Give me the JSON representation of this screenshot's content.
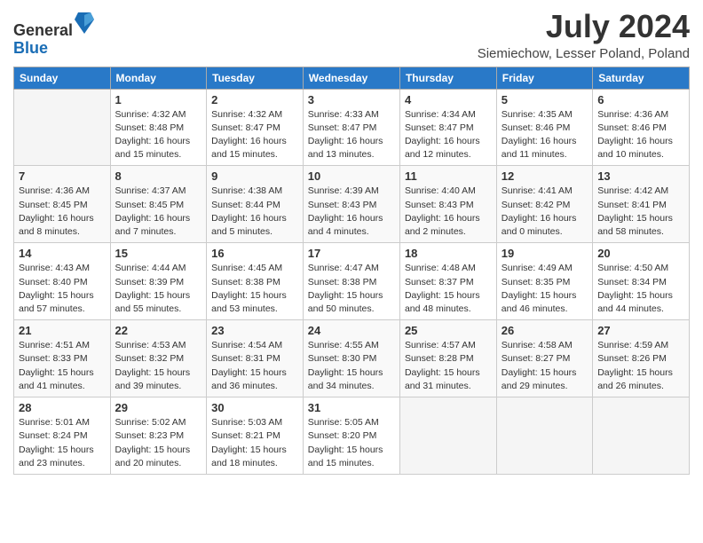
{
  "logo": {
    "text_general": "General",
    "text_blue": "Blue"
  },
  "title": {
    "month_year": "July 2024",
    "location": "Siemiechow, Lesser Poland, Poland"
  },
  "calendar": {
    "headers": [
      "Sunday",
      "Monday",
      "Tuesday",
      "Wednesday",
      "Thursday",
      "Friday",
      "Saturday"
    ],
    "weeks": [
      [
        {
          "day": "",
          "content": ""
        },
        {
          "day": "1",
          "content": "Sunrise: 4:32 AM\nSunset: 8:48 PM\nDaylight: 16 hours\nand 15 minutes."
        },
        {
          "day": "2",
          "content": "Sunrise: 4:32 AM\nSunset: 8:47 PM\nDaylight: 16 hours\nand 15 minutes."
        },
        {
          "day": "3",
          "content": "Sunrise: 4:33 AM\nSunset: 8:47 PM\nDaylight: 16 hours\nand 13 minutes."
        },
        {
          "day": "4",
          "content": "Sunrise: 4:34 AM\nSunset: 8:47 PM\nDaylight: 16 hours\nand 12 minutes."
        },
        {
          "day": "5",
          "content": "Sunrise: 4:35 AM\nSunset: 8:46 PM\nDaylight: 16 hours\nand 11 minutes."
        },
        {
          "day": "6",
          "content": "Sunrise: 4:36 AM\nSunset: 8:46 PM\nDaylight: 16 hours\nand 10 minutes."
        }
      ],
      [
        {
          "day": "7",
          "content": "Sunrise: 4:36 AM\nSunset: 8:45 PM\nDaylight: 16 hours\nand 8 minutes."
        },
        {
          "day": "8",
          "content": "Sunrise: 4:37 AM\nSunset: 8:45 PM\nDaylight: 16 hours\nand 7 minutes."
        },
        {
          "day": "9",
          "content": "Sunrise: 4:38 AM\nSunset: 8:44 PM\nDaylight: 16 hours\nand 5 minutes."
        },
        {
          "day": "10",
          "content": "Sunrise: 4:39 AM\nSunset: 8:43 PM\nDaylight: 16 hours\nand 4 minutes."
        },
        {
          "day": "11",
          "content": "Sunrise: 4:40 AM\nSunset: 8:43 PM\nDaylight: 16 hours\nand 2 minutes."
        },
        {
          "day": "12",
          "content": "Sunrise: 4:41 AM\nSunset: 8:42 PM\nDaylight: 16 hours\nand 0 minutes."
        },
        {
          "day": "13",
          "content": "Sunrise: 4:42 AM\nSunset: 8:41 PM\nDaylight: 15 hours\nand 58 minutes."
        }
      ],
      [
        {
          "day": "14",
          "content": "Sunrise: 4:43 AM\nSunset: 8:40 PM\nDaylight: 15 hours\nand 57 minutes."
        },
        {
          "day": "15",
          "content": "Sunrise: 4:44 AM\nSunset: 8:39 PM\nDaylight: 15 hours\nand 55 minutes."
        },
        {
          "day": "16",
          "content": "Sunrise: 4:45 AM\nSunset: 8:38 PM\nDaylight: 15 hours\nand 53 minutes."
        },
        {
          "day": "17",
          "content": "Sunrise: 4:47 AM\nSunset: 8:38 PM\nDaylight: 15 hours\nand 50 minutes."
        },
        {
          "day": "18",
          "content": "Sunrise: 4:48 AM\nSunset: 8:37 PM\nDaylight: 15 hours\nand 48 minutes."
        },
        {
          "day": "19",
          "content": "Sunrise: 4:49 AM\nSunset: 8:35 PM\nDaylight: 15 hours\nand 46 minutes."
        },
        {
          "day": "20",
          "content": "Sunrise: 4:50 AM\nSunset: 8:34 PM\nDaylight: 15 hours\nand 44 minutes."
        }
      ],
      [
        {
          "day": "21",
          "content": "Sunrise: 4:51 AM\nSunset: 8:33 PM\nDaylight: 15 hours\nand 41 minutes."
        },
        {
          "day": "22",
          "content": "Sunrise: 4:53 AM\nSunset: 8:32 PM\nDaylight: 15 hours\nand 39 minutes."
        },
        {
          "day": "23",
          "content": "Sunrise: 4:54 AM\nSunset: 8:31 PM\nDaylight: 15 hours\nand 36 minutes."
        },
        {
          "day": "24",
          "content": "Sunrise: 4:55 AM\nSunset: 8:30 PM\nDaylight: 15 hours\nand 34 minutes."
        },
        {
          "day": "25",
          "content": "Sunrise: 4:57 AM\nSunset: 8:28 PM\nDaylight: 15 hours\nand 31 minutes."
        },
        {
          "day": "26",
          "content": "Sunrise: 4:58 AM\nSunset: 8:27 PM\nDaylight: 15 hours\nand 29 minutes."
        },
        {
          "day": "27",
          "content": "Sunrise: 4:59 AM\nSunset: 8:26 PM\nDaylight: 15 hours\nand 26 minutes."
        }
      ],
      [
        {
          "day": "28",
          "content": "Sunrise: 5:01 AM\nSunset: 8:24 PM\nDaylight: 15 hours\nand 23 minutes."
        },
        {
          "day": "29",
          "content": "Sunrise: 5:02 AM\nSunset: 8:23 PM\nDaylight: 15 hours\nand 20 minutes."
        },
        {
          "day": "30",
          "content": "Sunrise: 5:03 AM\nSunset: 8:21 PM\nDaylight: 15 hours\nand 18 minutes."
        },
        {
          "day": "31",
          "content": "Sunrise: 5:05 AM\nSunset: 8:20 PM\nDaylight: 15 hours\nand 15 minutes."
        },
        {
          "day": "",
          "content": ""
        },
        {
          "day": "",
          "content": ""
        },
        {
          "day": "",
          "content": ""
        }
      ]
    ]
  }
}
